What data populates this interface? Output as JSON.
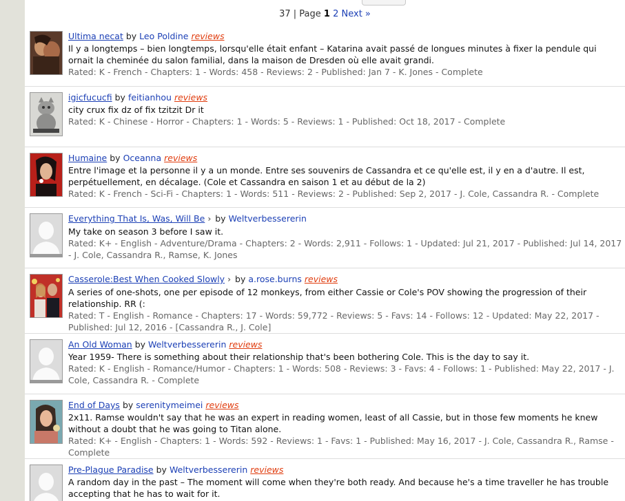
{
  "pager": {
    "count": "37",
    "sep": " | Page ",
    "current": "1",
    "page2": "2",
    "next": "Next »"
  },
  "stories": [
    {
      "title": "Ultima necat",
      "by": "by",
      "author": "Leo Poldine",
      "reviews": "reviews",
      "has_chevron": false,
      "summary": "Il y a longtemps – bien longtemps, lorsqu'elle était enfant – Katarina avait passé de longues minutes à fixer la pendule qui ornait la cheminée du salon familial, dans la maison de Dresden où elle avait grandi.",
      "meta": "Rated: K - French - Chapters: 1 - Words: 458 - Reviews: 2 - Published: Jan 7 - K. Jones - Complete",
      "thumb": "couple-photo"
    },
    {
      "title": "igicfucucfi",
      "by": "by",
      "author": "feitianhou",
      "reviews": "reviews",
      "has_chevron": false,
      "summary": "city crux fix dz of fix tzitzit Dr it",
      "meta": "Rated: K - Chinese - Horror - Chapters: 1 - Words: 5 - Reviews: 1 - Published: Oct 18, 2017 - Complete",
      "thumb": "cat-photo"
    },
    {
      "title": "Humaine",
      "by": "by",
      "author": "Oceanna",
      "reviews": "reviews",
      "has_chevron": false,
      "summary": "Entre l'image et la personne il y a un monde. Entre ses souvenirs de Cassandra et ce qu'elle est, il y en a d'autre. Il est, perpétuellement, en décalage. (Cole et Cassandra en saison 1 et au début de la 2)",
      "meta": "Rated: K - French - Sci-Fi - Chapters: 1 - Words: 511 - Reviews: 2 - Published: Sep 2, 2017 - J. Cole, Cassandra R. - Complete",
      "thumb": "woman-red-photo"
    },
    {
      "title": "Everything That Is, Was, Will Be",
      "by": "by",
      "author": "Weltverbessererin",
      "reviews": "",
      "has_chevron": true,
      "summary": "My take on season 3 before I saw it.",
      "meta": "Rated: K+ - English - Adventure/Drama - Chapters: 2 - Words: 2,911 - Follows: 1 - Updated: Jul 21, 2017 - Published: Jul 14, 2017 - J. Cole, Cassandra R., Ramse, K. Jones",
      "thumb": "default-avatar"
    },
    {
      "title": "Casserole:Best When Cooked Slowly",
      "by": "by",
      "author": "a.rose.burns",
      "reviews": "reviews",
      "has_chevron": true,
      "summary": "A series of one-shots, one per episode of 12 monkeys, from either Cassie or Cole's POV showing the progression of their relationship. RR (:",
      "meta": "Rated: T - English - Romance - Chapters: 17 - Words: 59,772 - Reviews: 5 - Favs: 14 - Follows: 12 - Updated: May 22, 2017 - Published: Jul 12, 2016 - [Cassandra R., J. Cole]",
      "thumb": "couple-party-photo"
    },
    {
      "title": "An Old Woman",
      "by": "by",
      "author": "Weltverbessererin",
      "reviews": "reviews",
      "has_chevron": false,
      "summary": "Year 1959- There is something about their relationship that's been bothering Cole. This is the day to say it.",
      "meta": "Rated: K - English - Romance/Humor - Chapters: 1 - Words: 508 - Reviews: 3 - Favs: 4 - Follows: 1 - Published: May 22, 2017 - J. Cole, Cassandra R. - Complete",
      "thumb": "default-avatar"
    },
    {
      "title": "End of Days",
      "by": "by",
      "author": "serenitymeimei",
      "reviews": "reviews",
      "has_chevron": false,
      "summary": "2x11. Ramse wouldn't say that he was an expert in reading women, least of all Cassie, but in those few moments he knew without a doubt that he was going to Titan alone.",
      "meta": "Rated: K+ - English - Chapters: 1 - Words: 592 - Reviews: 1 - Favs: 1 - Published: May 16, 2017 - J. Cole, Cassandra R., Ramse - Complete",
      "thumb": "woman-photo"
    },
    {
      "title": "Pre-Plague Paradise",
      "by": "by",
      "author": "Weltverbessererin",
      "reviews": "reviews",
      "has_chevron": false,
      "summary": "A random day in the past – The moment will come when they're both ready. And because he's a time traveller he has trouble accepting that he has to wait for it.",
      "meta": "",
      "thumb": "default-avatar"
    }
  ],
  "colors": {
    "link": "#1b3fb5",
    "reviews": "#e03c0e",
    "meta": "#666666",
    "side": "#e2e2da"
  }
}
